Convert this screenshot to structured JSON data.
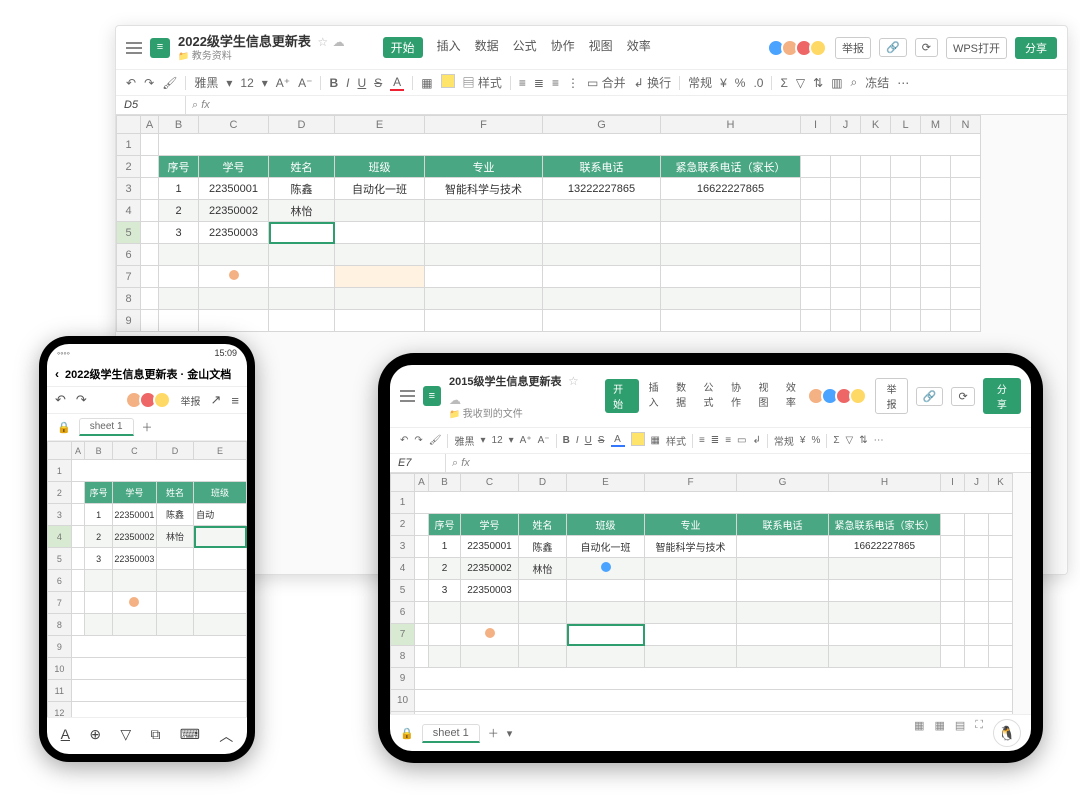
{
  "columns_headers": [
    "序号",
    "学号",
    "姓名",
    "班级",
    "专业",
    "联系电话",
    "紧急联系电话（家长）"
  ],
  "rows": [
    {
      "n": "1",
      "id": "22350001",
      "name": "陈鑫",
      "class": "自动化一班",
      "major": "智能科学与技术",
      "phone": "13222227865",
      "emergency": "16622227865"
    },
    {
      "n": "2",
      "id": "22350002",
      "name": "林怡",
      "class": "",
      "major": "",
      "phone": "",
      "emergency": ""
    },
    {
      "n": "3",
      "id": "22350003",
      "name": "",
      "class": "",
      "major": "",
      "phone": "",
      "emergency": ""
    }
  ],
  "main": {
    "doc_title": "2022级学生信息更新表",
    "folder": "教务资料",
    "tabs": [
      "开始",
      "插入",
      "数据",
      "公式",
      "协作",
      "视图",
      "效率"
    ],
    "namebox": "D5",
    "font_name": "雅黑",
    "font_size": "12",
    "toolbar_labels": {
      "format": "样式",
      "merge": "合并",
      "wrap": "换行",
      "general": "常规",
      "freeze": "冻结"
    },
    "right_btns": {
      "report": "举报",
      "wps": "WPS打开",
      "share": "分享"
    },
    "col_letters": [
      "A",
      "B",
      "C",
      "D",
      "E",
      "F",
      "G",
      "H",
      "I",
      "J",
      "K",
      "L",
      "M",
      "N"
    ]
  },
  "tablet": {
    "doc_title": "2015级学生信息更新表",
    "folder": "我收到的文件",
    "tabs": [
      "开始",
      "插入",
      "数据",
      "公式",
      "协作",
      "视图",
      "效率"
    ],
    "namebox": "E7",
    "font_name": "雅黑",
    "font_size": "12",
    "toolbar_labels": {
      "format": "样式",
      "general": "常规"
    },
    "right_btns": {
      "report": "举报",
      "share": "分享"
    },
    "sheet_name": "sheet 1",
    "col_letters": [
      "A",
      "B",
      "C",
      "D",
      "E",
      "F",
      "G",
      "H",
      "I",
      "J",
      "K"
    ],
    "row3": {
      "major": "智能科学与技术",
      "emergency": "16622227865"
    }
  },
  "phone": {
    "status_left": "◦◦◦◦",
    "status_right": "15:09",
    "doc_title": "2022级学生信息更新表 · 金山文档",
    "report": "举报",
    "sheet_name": "sheet 1",
    "col_letters": [
      "A",
      "B",
      "C",
      "D",
      "E"
    ],
    "headers": [
      "序号",
      "学号",
      "姓名",
      "班级"
    ]
  }
}
